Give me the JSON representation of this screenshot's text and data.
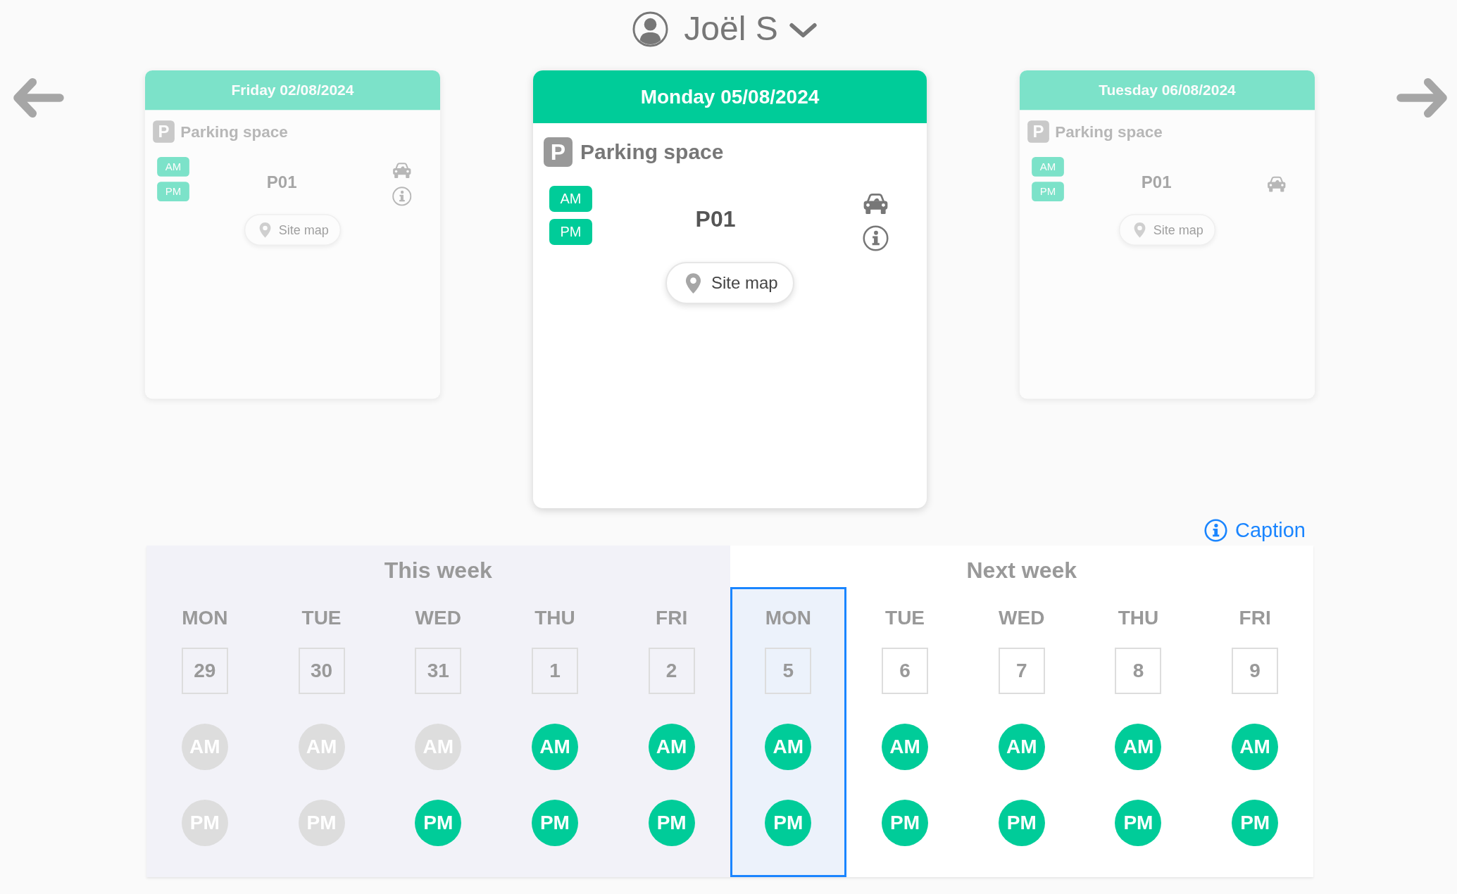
{
  "user_menu": {
    "name": "Joël S"
  },
  "carousel": {
    "days": [
      {
        "date": "Friday 02/08/2024",
        "selected": false,
        "sign": "P",
        "heading": "Parking space",
        "slots": [
          "AM",
          "PM"
        ],
        "spot": "P01",
        "info": true,
        "map_button": "Site map"
      },
      {
        "date": "Monday 05/08/2024",
        "selected": true,
        "sign": "P",
        "heading": "Parking space",
        "slots": [
          "AM",
          "PM"
        ],
        "spot": "P01",
        "info": true,
        "map_button": "Site map"
      },
      {
        "date": "Tuesday 06/08/2024",
        "selected": false,
        "sign": "P",
        "heading": "Parking space",
        "slots": [
          "AM",
          "PM"
        ],
        "spot": "P01",
        "info": false,
        "map_button": "Site map"
      }
    ]
  },
  "caption_link": "Caption",
  "weeks": [
    {
      "title": "This week",
      "current": true,
      "days": [
        {
          "weekday": "MON",
          "date": "29",
          "selected": false,
          "slots": [
            {
              "label": "AM",
              "booked": false
            },
            {
              "label": "PM",
              "booked": false
            }
          ]
        },
        {
          "weekday": "TUE",
          "date": "30",
          "selected": false,
          "slots": [
            {
              "label": "AM",
              "booked": false
            },
            {
              "label": "PM",
              "booked": false
            }
          ]
        },
        {
          "weekday": "WED",
          "date": "31",
          "selected": false,
          "slots": [
            {
              "label": "AM",
              "booked": false
            },
            {
              "label": "PM",
              "booked": true
            }
          ]
        },
        {
          "weekday": "THU",
          "date": "1",
          "selected": false,
          "slots": [
            {
              "label": "AM",
              "booked": true
            },
            {
              "label": "PM",
              "booked": true
            }
          ]
        },
        {
          "weekday": "FRI",
          "date": "2",
          "selected": false,
          "slots": [
            {
              "label": "AM",
              "booked": true
            },
            {
              "label": "PM",
              "booked": true
            }
          ]
        }
      ]
    },
    {
      "title": "Next week",
      "current": false,
      "days": [
        {
          "weekday": "MON",
          "date": "5",
          "selected": true,
          "slots": [
            {
              "label": "AM",
              "booked": true
            },
            {
              "label": "PM",
              "booked": true
            }
          ]
        },
        {
          "weekday": "TUE",
          "date": "6",
          "selected": false,
          "slots": [
            {
              "label": "AM",
              "booked": true
            },
            {
              "label": "PM",
              "booked": true
            }
          ]
        },
        {
          "weekday": "WED",
          "date": "7",
          "selected": false,
          "slots": [
            {
              "label": "AM",
              "booked": true
            },
            {
              "label": "PM",
              "booked": true
            }
          ]
        },
        {
          "weekday": "THU",
          "date": "8",
          "selected": false,
          "slots": [
            {
              "label": "AM",
              "booked": true
            },
            {
              "label": "PM",
              "booked": true
            }
          ]
        },
        {
          "weekday": "FRI",
          "date": "9",
          "selected": false,
          "slots": [
            {
              "label": "AM",
              "booked": true
            },
            {
              "label": "PM",
              "booked": true
            }
          ]
        }
      ]
    }
  ]
}
